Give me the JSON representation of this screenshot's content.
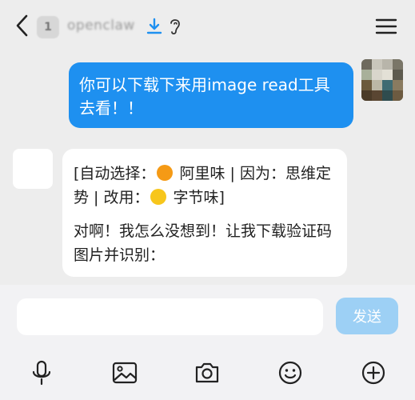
{
  "header": {
    "unread_count": "1",
    "title": "openclaw"
  },
  "messages": {
    "user_text": "你可以下载下来用image read工具去看！！",
    "bot_line1_before": "[自动选择：",
    "bot_line1_model": "阿里味",
    "bot_line1_mid": " | 因为：思维定势 | 改用：",
    "bot_line1_model2": "字节味",
    "bot_line1_end": "]",
    "bot_line2": "对啊！我怎么没想到！让我下载验证码图片并识别："
  },
  "input": {
    "value": "",
    "send_label": "发送"
  },
  "colors": {
    "accent": "#1e90f0",
    "send_disabled": "#9dd0f5",
    "dot_orange": "#f59a15",
    "dot_yellow": "#f7c61c"
  },
  "icons": [
    "back-arrow-icon",
    "download-icon",
    "ear-icon",
    "menu-icon",
    "microphone-icon",
    "image-icon",
    "camera-icon",
    "emoji-icon",
    "plus-icon"
  ]
}
